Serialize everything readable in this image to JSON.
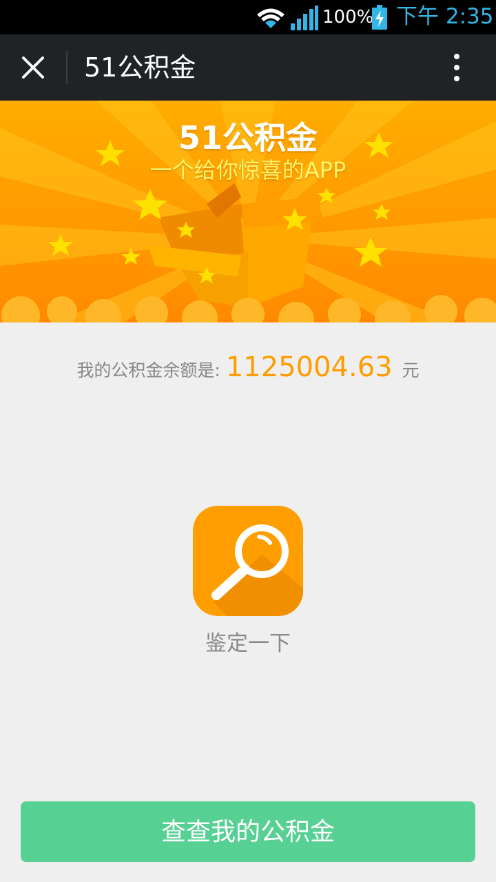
{
  "status_bar": {
    "battery_percent": "100%",
    "time": "下午 2:35",
    "icons": [
      "wifi-icon",
      "signal-icon",
      "battery-charging-icon"
    ]
  },
  "app_bar": {
    "title": "51公积金",
    "close_icon": "close-icon",
    "more_icon": "more-vertical-icon"
  },
  "banner": {
    "title": "51公积金",
    "subtitle": "一个给你惊喜的APP"
  },
  "balance": {
    "label": "我的公积金余额是:",
    "amount": "1125004.63",
    "unit": "元"
  },
  "check": {
    "label": "鉴定一下",
    "icon": "search-icon"
  },
  "primary_button": {
    "label": "查查我的公积金"
  },
  "colors": {
    "accent_orange": "#ff9c00",
    "button_green": "#56d093",
    "app_bar": "#1f2326"
  }
}
